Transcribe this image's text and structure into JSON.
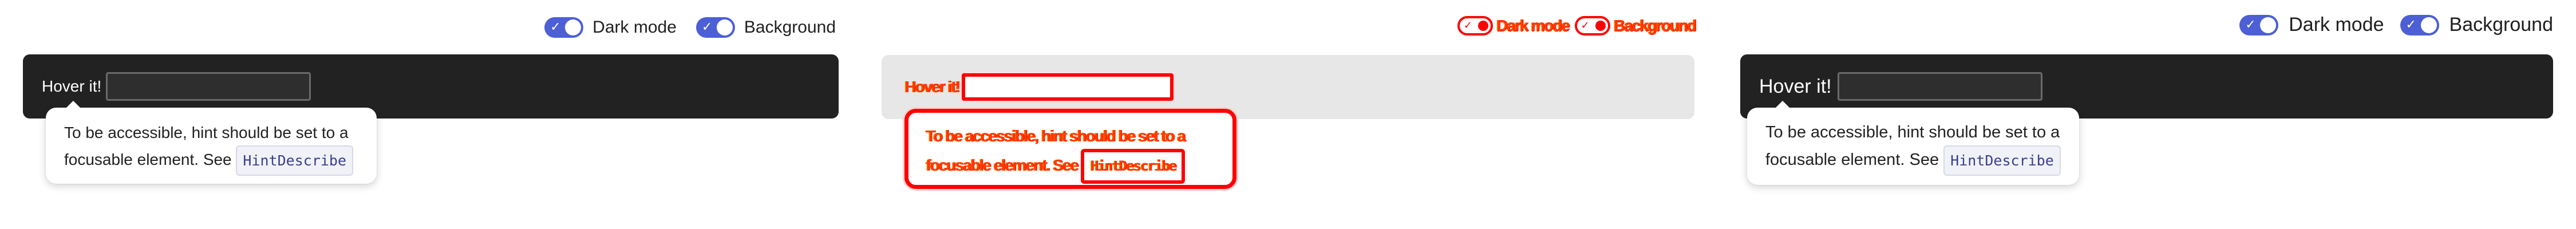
{
  "toggles": {
    "dark_mode_label": "Dark mode",
    "background_label": "Background",
    "check_glyph": "✓"
  },
  "demo": {
    "hover_label": "Hover it!",
    "input_value": ""
  },
  "tooltip": {
    "text": "To be accessible, hint should be set to a focusable element. See ",
    "code": "HintDescribe"
  },
  "colors": {
    "accent": "#4c5fd5",
    "bar_dark": "#222222",
    "bar_light": "#e7e7e7",
    "debug_outline": "#ff0000"
  }
}
